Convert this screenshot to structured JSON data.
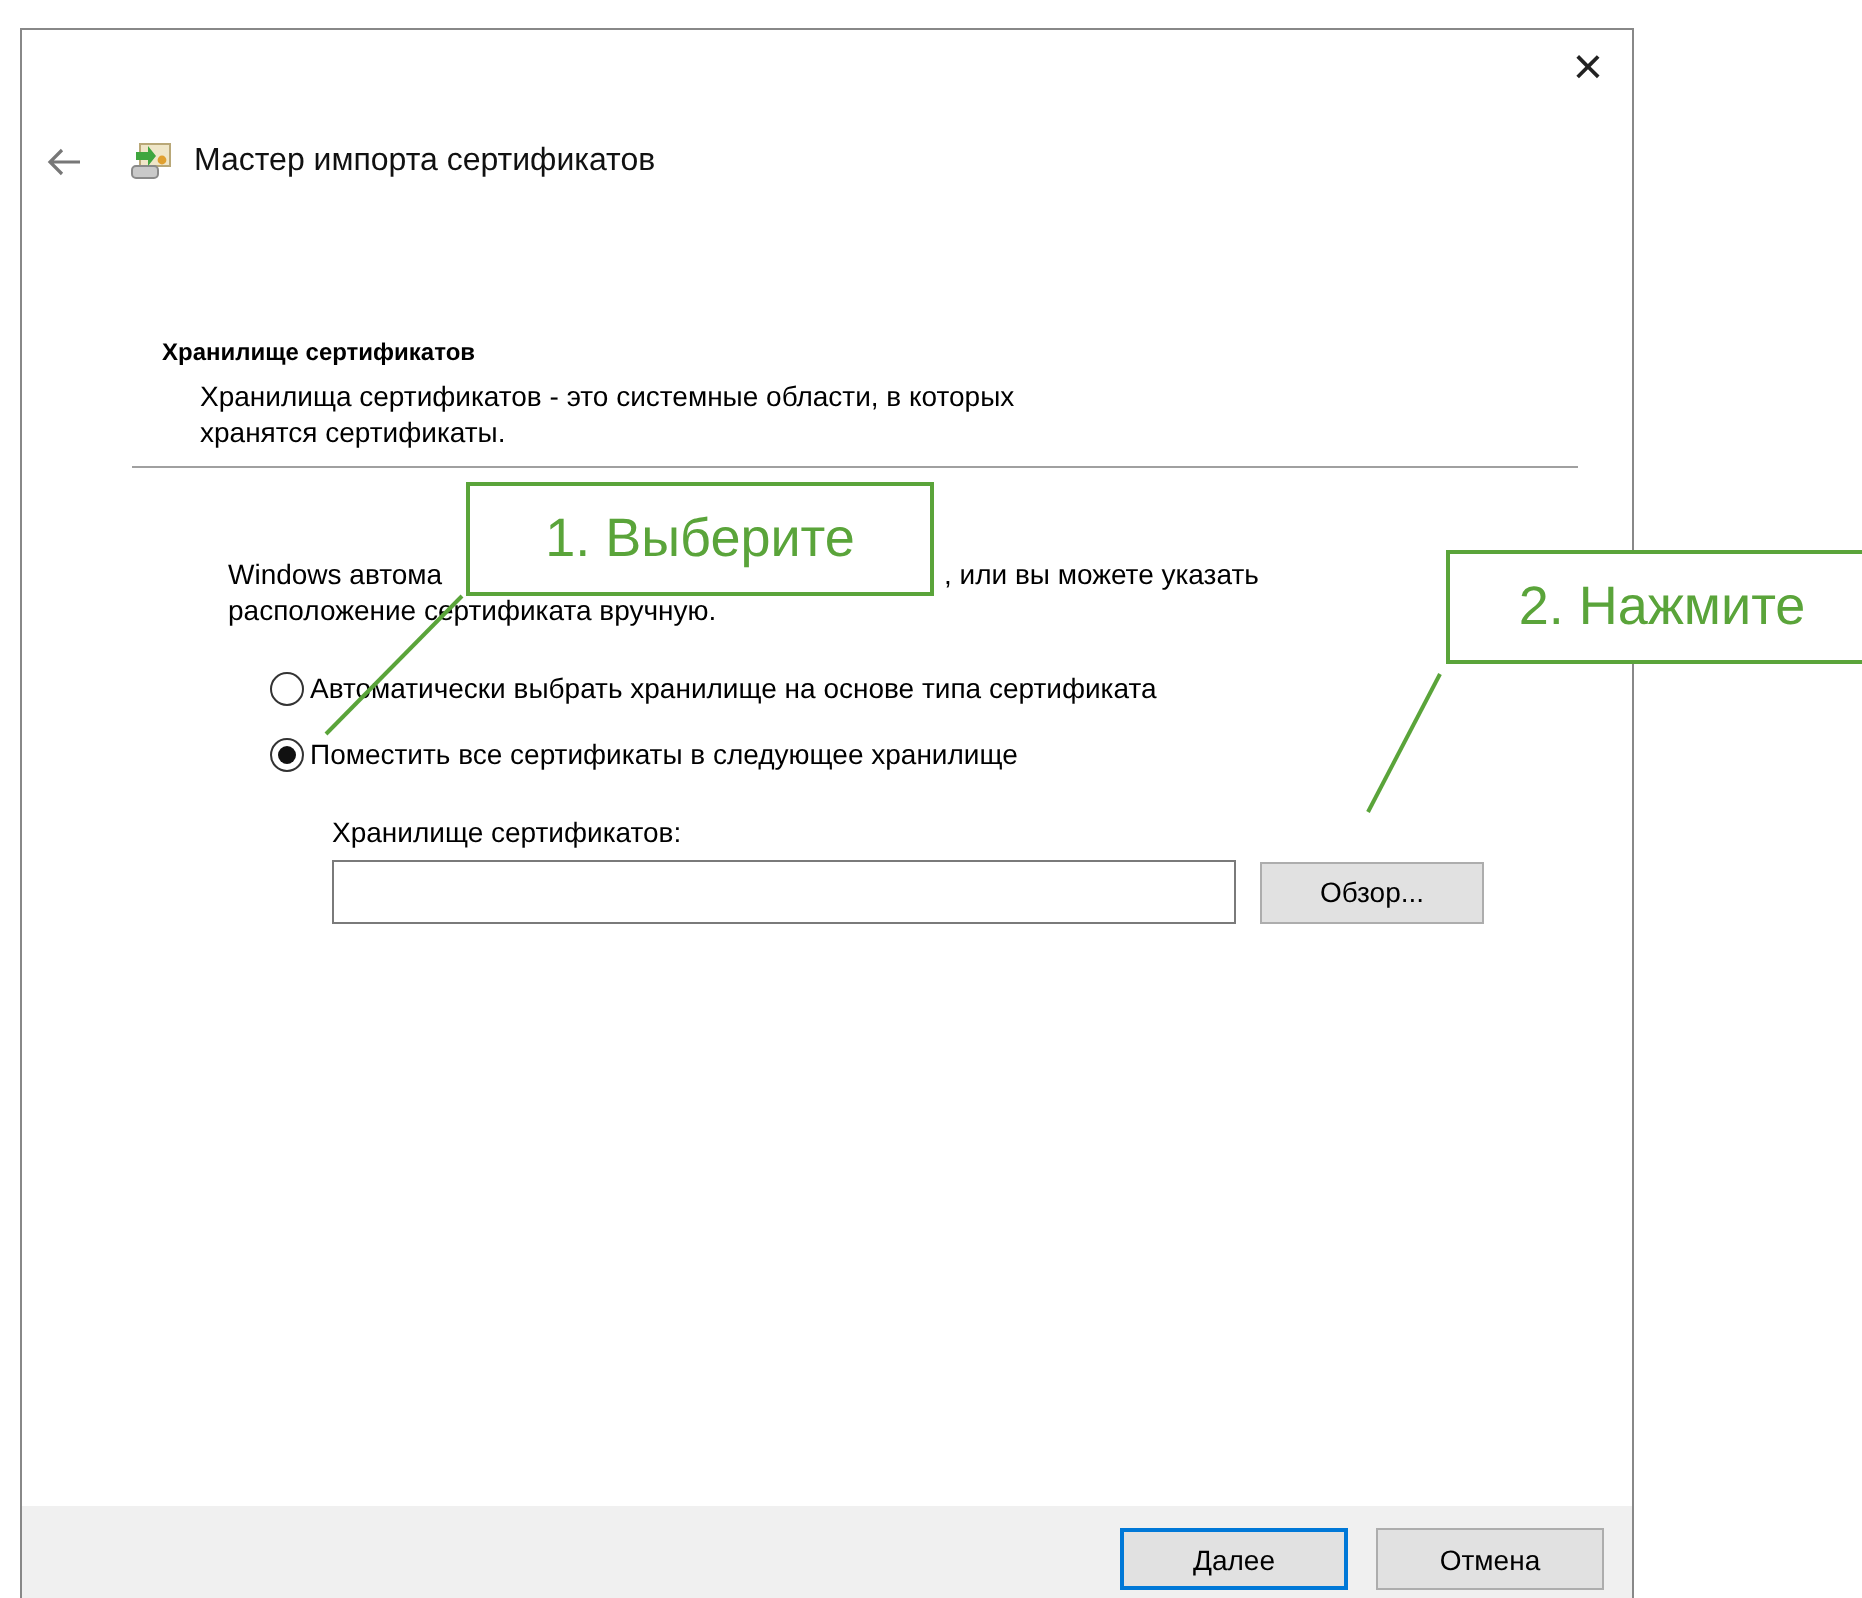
{
  "window": {
    "title": "Мастер импорта сертификатов",
    "close": "×"
  },
  "section": {
    "heading": "Хранилище сертификатов",
    "description": "Хранилища сертификатов - это системные области, в которых хранятся сертификаты."
  },
  "intro": {
    "line_1_start": "Windows автома",
    "line_1_end": ", или вы можете указать",
    "line_2": "расположение сертификата вручную."
  },
  "options": [
    {
      "label": "Автоматически выбрать хранилище на основе типа сертификата",
      "selected": false
    },
    {
      "label": "Поместить все сертификаты в следующее хранилище",
      "selected": true
    }
  ],
  "store": {
    "label": "Хранилище сертификатов:",
    "browse_button": "Обзор..."
  },
  "buttons": [
    {
      "label": "Далее",
      "default": true
    },
    {
      "label": "Отмена",
      "default": false
    }
  ],
  "callouts": [
    "1. Выберите",
    "2. Нажмите"
  ]
}
